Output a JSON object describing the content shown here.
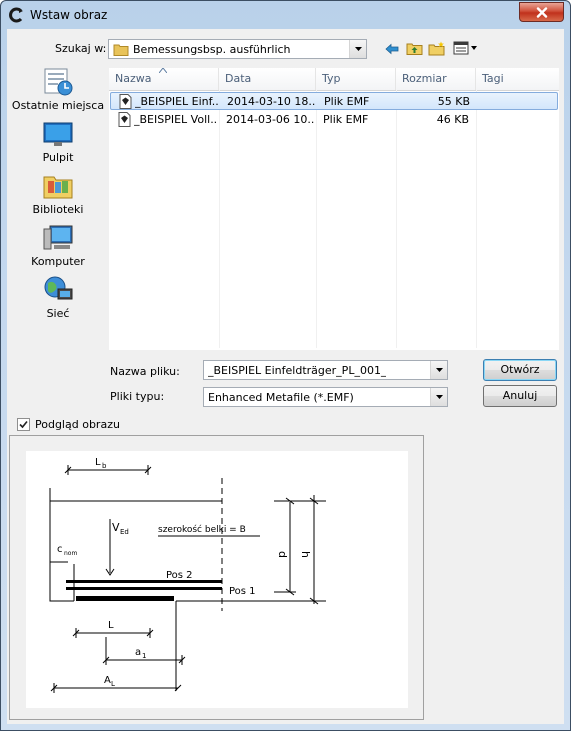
{
  "window": {
    "title": "Wstaw obraz"
  },
  "lookin": {
    "label": "Szukaj w:",
    "value": "Bemessungsbsp. ausführlich"
  },
  "toolbar_icons": [
    "back-icon",
    "up-folder-icon",
    "new-folder-icon",
    "view-menu-icon"
  ],
  "places": [
    {
      "label": "Ostatnie miejsca",
      "icon": "recent-places-icon"
    },
    {
      "label": "Pulpit",
      "icon": "desktop-icon"
    },
    {
      "label": "Biblioteki",
      "icon": "libraries-icon"
    },
    {
      "label": "Komputer",
      "icon": "computer-icon"
    },
    {
      "label": "Sieć",
      "icon": "network-icon"
    }
  ],
  "columns": [
    "Nazwa",
    "Data",
    "Typ",
    "Rozmiar",
    "Tagi"
  ],
  "files": [
    {
      "name": "_BEISPIEL Einf...",
      "date": "2014-03-10 18...",
      "type": "Plik EMF",
      "size": "55 KB",
      "tags": "",
      "selected": true
    },
    {
      "name": "_BEISPIEL Voll...",
      "date": "2014-03-06 10...",
      "type": "Plik EMF",
      "size": "46 KB",
      "tags": "",
      "selected": false
    }
  ],
  "filename": {
    "label": "Nazwa pliku:",
    "value": "_BEISPIEL Einfeldträger_PL_001_"
  },
  "filetype": {
    "label": "Pliki typu:",
    "value": "Enhanced Metafile  (*.EMF)"
  },
  "buttons": {
    "open": "Otwórz",
    "cancel": "Anuluj"
  },
  "preview": {
    "checkbox_label": "Podgląd obrazu",
    "checked": true,
    "drawing_labels": {
      "lb": "L",
      "lb_sub": "b",
      "ved": "V",
      "ved_sub": "Ed",
      "width_text": "szerokość belki = B",
      "cnom": "c",
      "cnom_sub": "nom",
      "d": "d",
      "h": "h",
      "pos2": "Pos  2",
      "pos1": "Pos  1",
      "l": "L",
      "a1": "a",
      "a1_sub": "1",
      "al": "A",
      "al_sub": "L"
    }
  }
}
